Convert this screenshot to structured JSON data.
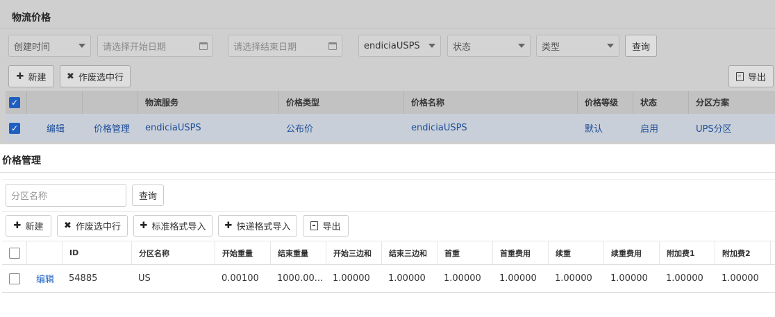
{
  "background": {
    "title": "物流价格",
    "filters": {
      "created_time": "创建时间",
      "start_date_placeholder": "请选择开始日期",
      "end_date_placeholder": "请选择结束日期",
      "service": "endiciaUSPS",
      "status": "状态",
      "type": "类型",
      "query_label": "查询"
    },
    "toolbar": {
      "new_label": "新建",
      "void_label": "作废选中行",
      "export_label": "导出"
    },
    "table": {
      "headers": [
        "物流服务",
        "价格类型",
        "价格名称",
        "价格等级",
        "状态",
        "分区方案"
      ],
      "row": {
        "edit": "编辑",
        "price_manage": "价格管理",
        "service": "endiciaUSPS",
        "price_type": "公布价",
        "price_name": "endiciaUSPS",
        "level": "默认",
        "status": "启用",
        "zone_plan": "UPS分区"
      }
    }
  },
  "dialog": {
    "title": "价格管理",
    "search_placeholder": "分区名称",
    "query_label": "查询",
    "toolbar": {
      "new_label": "新建",
      "void_label": "作废选中行",
      "std_import_label": "标准格式导入",
      "express_import_label": "快递格式导入",
      "export_label": "导出"
    },
    "table": {
      "headers": [
        "ID",
        "分区名称",
        "开始重量",
        "结束重量",
        "开始三边和",
        "结束三边和",
        "首重",
        "首重费用",
        "续重",
        "续重费用",
        "附加费1",
        "附加费2"
      ],
      "rows": [
        {
          "edit": "编辑",
          "cells": [
            "54885",
            "US",
            "0.00100",
            "1000.00...",
            "1.00000",
            "1.00000",
            "1.00000",
            "1.00000",
            "1.00000",
            "1.00000",
            "1.00000",
            "1.00000"
          ]
        }
      ]
    }
  }
}
